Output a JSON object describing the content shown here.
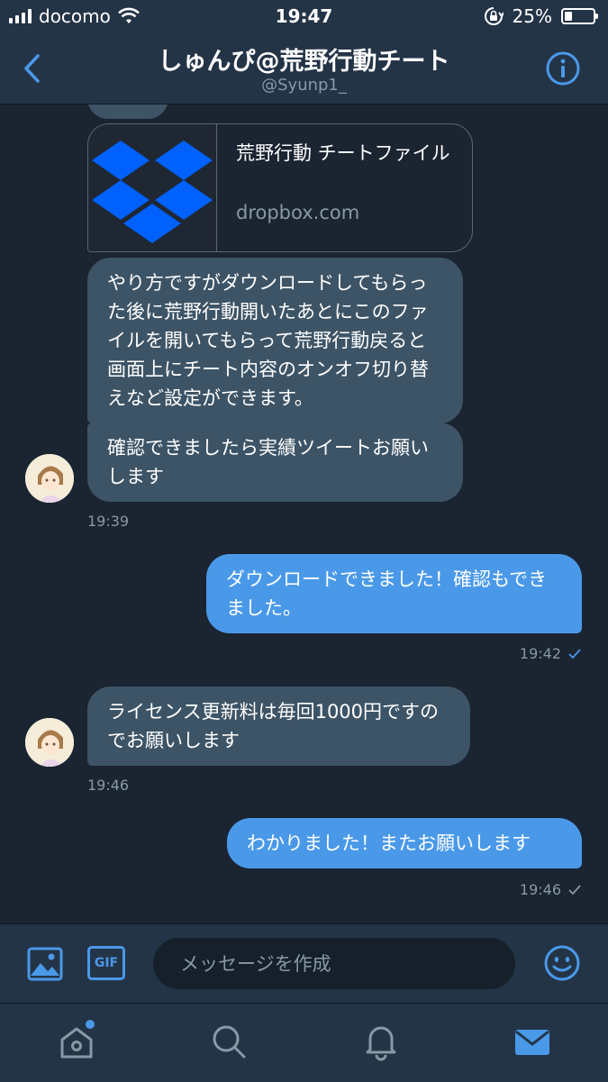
{
  "status_bar": {
    "carrier": "docomo",
    "time": "19:47",
    "battery_percent": "25%",
    "battery_level": 0.25
  },
  "header": {
    "title": "しゅんぴ@荒野行動チート",
    "handle": "@Syunp1_"
  },
  "link_card": {
    "title": "荒野行動 チートファイル",
    "domain": "dropbox.com",
    "thumbnail_icon": "dropbox-logo",
    "brand_color": "#0061fe"
  },
  "messages": [
    {
      "side": "in",
      "text": "やり方ですがダウンロードしてもらった後に荒野行動開いたあとにこのファイルを開いてもらって荒野行動戻ると画面上にチート内容のオンオフ切り替えなど設定ができます。"
    },
    {
      "side": "in",
      "text": "確認できましたら実績ツイートお願いします",
      "time": "19:39"
    },
    {
      "side": "out",
      "text": "ダウンロードできました！確認もできました。",
      "time": "19:42",
      "read": true
    },
    {
      "side": "in",
      "text": "ライセンス更新料は毎回1000円ですのでお願いします",
      "time": "19:46"
    },
    {
      "side": "out",
      "text": "わかりました！またお願いします",
      "time": "19:46",
      "read": false
    }
  ],
  "composer": {
    "placeholder": "メッセージを作成",
    "gif_label": "GIF"
  },
  "tabs": [
    "home",
    "search",
    "notifications",
    "messages"
  ],
  "colors": {
    "accent": "#4a99e9",
    "background": "#1b2431",
    "bar": "#243447",
    "incoming_bubble": "#3d5466",
    "outgoing_bubble": "#4a99e9",
    "muted": "#8899a6"
  }
}
